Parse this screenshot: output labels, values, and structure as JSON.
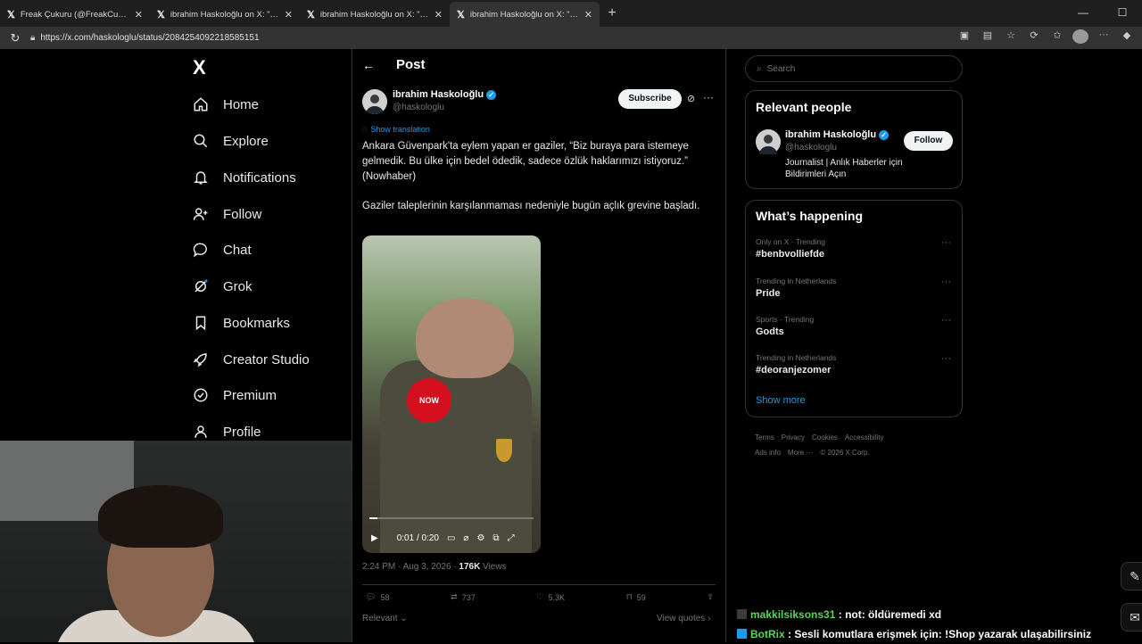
{
  "browser": {
    "tabs": [
      {
        "title": "Freak Çukuru (@FreakCukuruX) / X"
      },
      {
        "title": "ibrahim Haskoloğlu on X: \"Türkiye"
      },
      {
        "title": "ibrahim Haskoloğlu on X: \"Kemal"
      },
      {
        "title": "ibrahim Haskoloğlu on X: \"Ankara"
      }
    ],
    "new_tab": "+",
    "url": "https://x.com/haskologlu/status/2084254092218585151"
  },
  "nav": {
    "logo": "X",
    "items": [
      {
        "label": "Home",
        "icon": "home-icon"
      },
      {
        "label": "Explore",
        "icon": "search-icon"
      },
      {
        "label": "Notifications",
        "icon": "bell-icon"
      },
      {
        "label": "Follow",
        "icon": "person-add-icon"
      },
      {
        "label": "Chat",
        "icon": "chat-icon"
      },
      {
        "label": "Grok",
        "icon": "grok-icon"
      },
      {
        "label": "Bookmarks",
        "icon": "bookmark-icon"
      },
      {
        "label": "Creator Studio",
        "icon": "rocket-icon"
      },
      {
        "label": "Premium",
        "icon": "verified-icon"
      },
      {
        "label": "Profile",
        "icon": "person-icon"
      }
    ]
  },
  "post": {
    "header_title": "Post",
    "author_name": "ibrahim Haskoloğlu",
    "author_handle": "@haskologlu",
    "subscribe_label": "Subscribe",
    "show_translation": "Show translation",
    "text_1": "Ankara Güvenpark'ta eylem yapan er gaziler, “Biz buraya para istemeye gelmedik. Bu ülke için bedel ödedik, sadece özlük haklarımızı istiyoruz.” (Nowhaber)",
    "text_2": "Gaziler taleplerinin karşılanmaması nedeniyle bugün açlık grevine başladı.",
    "video": {
      "time": "0:01 / 0:20",
      "mic_label": "NOW",
      "progress": 0.05
    },
    "timestamp": "2:24 PM · Aug 3, 2026 · ",
    "views_count": "176K",
    "views_label": " Views",
    "actions": {
      "replies": "58",
      "reposts": "737",
      "likes": "5.3K",
      "bookmarks": "59"
    },
    "relevant_label": "Relevant ⌄",
    "view_quotes": "View quotes ›"
  },
  "sidebar": {
    "search_placeholder": "Search",
    "relevant_people_title": "Relevant people",
    "person": {
      "name": "ibrahim Haskoloğlu",
      "handle": "@haskologlu",
      "bio": "Journalist | Anlık Haberler için Bildirimleri Açın",
      "follow_label": "Follow"
    },
    "happening_title": "What’s happening",
    "trends": [
      {
        "context": "Only on X · Trending",
        "name": "#benbvolliefde"
      },
      {
        "context": "Trending in Netherlands",
        "name": "Pride"
      },
      {
        "context": "Sports · Trending",
        "name": "Godts"
      },
      {
        "context": "Trending in Netherlands",
        "name": "#deoranjezomer"
      }
    ],
    "show_more": "Show more",
    "footer_links": [
      "Terms",
      "Privacy",
      "Cookies",
      "Accessibility",
      "Ads info",
      "More ···",
      "© 2026 X Corp."
    ]
  },
  "chat": {
    "messages": [
      {
        "user": "makkilsiksons31",
        "text": " : not: öldüremedi xd"
      },
      {
        "user": "BotRix",
        "text": " : Sesli komutlara erişmek için: !Shop yazarak ulaşabilirsiniz"
      }
    ]
  },
  "colors": {
    "accent": "#1d9bf0",
    "background": "#000000",
    "border": "#2f3336",
    "chat_user": "#57d757"
  }
}
